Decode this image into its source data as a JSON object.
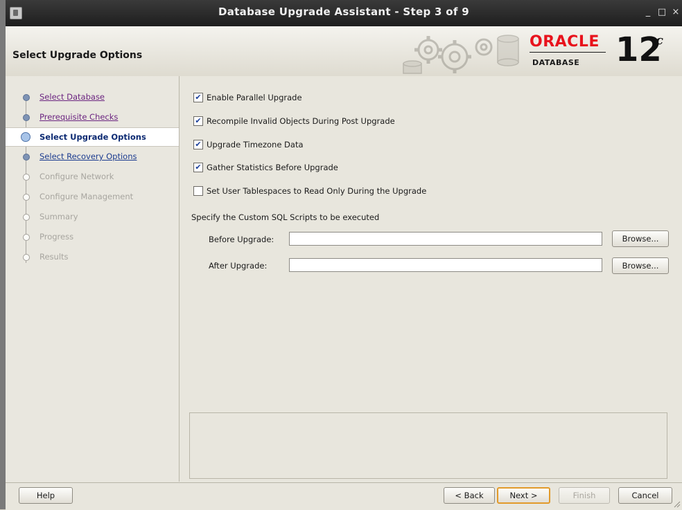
{
  "window": {
    "title": "Database Upgrade Assistant - Step 3 of 9",
    "controls": {
      "minimize": "_",
      "maximize": "□",
      "close": "×"
    }
  },
  "header": {
    "page_title": "Select Upgrade Options",
    "logo": {
      "brand": "ORACLE",
      "product": "DATABASE",
      "version": "12",
      "suffix": "c"
    }
  },
  "nav": {
    "items": [
      {
        "label": "Select Database",
        "state": "visited"
      },
      {
        "label": "Prerequisite Checks",
        "state": "visited"
      },
      {
        "label": "Select Upgrade Options",
        "state": "current"
      },
      {
        "label": "Select Recovery Options",
        "state": "link"
      },
      {
        "label": "Configure Network",
        "state": "future"
      },
      {
        "label": "Configure Management",
        "state": "future"
      },
      {
        "label": "Summary",
        "state": "future"
      },
      {
        "label": "Progress",
        "state": "future"
      },
      {
        "label": "Results",
        "state": "future"
      }
    ]
  },
  "options": [
    {
      "label": "Enable Parallel Upgrade",
      "checked": true
    },
    {
      "label": "Recompile Invalid Objects During Post Upgrade",
      "checked": true
    },
    {
      "label": "Upgrade Timezone Data",
      "checked": true
    },
    {
      "label": "Gather Statistics Before Upgrade",
      "checked": true
    },
    {
      "label": "Set User Tablespaces to Read Only During the Upgrade",
      "checked": false
    }
  ],
  "scripts": {
    "section_title": "Specify the Custom SQL Scripts to be executed",
    "before": {
      "label": "Before Upgrade:",
      "value": "",
      "browse_label": "Browse..."
    },
    "after": {
      "label": "After Upgrade:",
      "value": "",
      "browse_label": "Browse..."
    }
  },
  "footer": {
    "help": "Help",
    "back": "< Back",
    "next": "Next >",
    "finish": "Finish",
    "cancel": "Cancel"
  },
  "colors": {
    "title_bar": "#2b2b2b",
    "oracle_red": "#e8121c",
    "visited_link": "#6b2480",
    "current_step": "#0c2a72",
    "focus_ring": "#e29a2a"
  },
  "icons": {
    "app": "java-app-icon",
    "header_art": "gears-database-icon",
    "check": "check-mark-icon"
  }
}
